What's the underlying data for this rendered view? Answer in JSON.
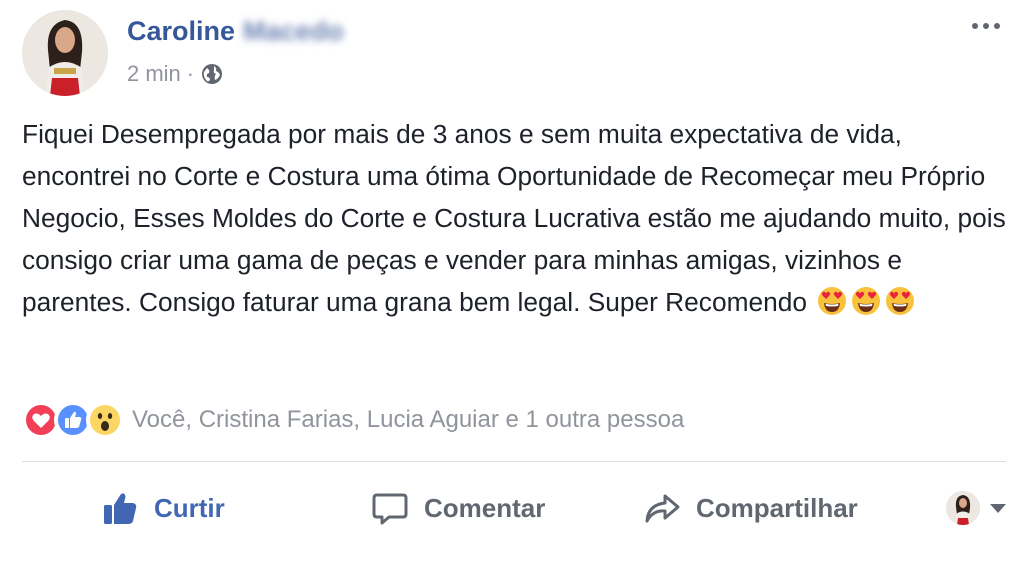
{
  "post": {
    "author_first": "Caroline",
    "author_last": "Macedo",
    "time": "2 min",
    "separator": "·",
    "privacy_icon": "globe-icon",
    "text": "Fiquei Desempregada por mais de 3 anos e sem muita expectativa de vida, encontrei no Corte e Costura uma ótima Oportunidade de Recomeçar meu Próprio Negocio, Esses Moldes do Corte e Costura Lucrativa estão me ajudando muito, pois consigo criar uma gama de peças e vender para minhas amigas, vizinhos e parentes. Consigo faturar uma grana bem legal. Super Recomendo",
    "emojis": [
      "heart-eyes-emoji",
      "heart-eyes-emoji",
      "heart-eyes-emoji"
    ]
  },
  "reactions": {
    "icons": [
      "love-reaction-icon",
      "like-reaction-icon",
      "wow-reaction-icon"
    ],
    "summary": "Você, Cristina Farias, Lucia Aguiar e 1 outra pessoa",
    "colors": {
      "love": "#f33e58",
      "like": "#5890ff",
      "wow": "#fcd664"
    }
  },
  "actions": {
    "like": "Curtir",
    "comment": "Comentar",
    "share": "Compartilhar"
  },
  "colors": {
    "link": "#365899",
    "like_active": "#4267b2",
    "secondary": "#90949c",
    "action": "#606770"
  }
}
